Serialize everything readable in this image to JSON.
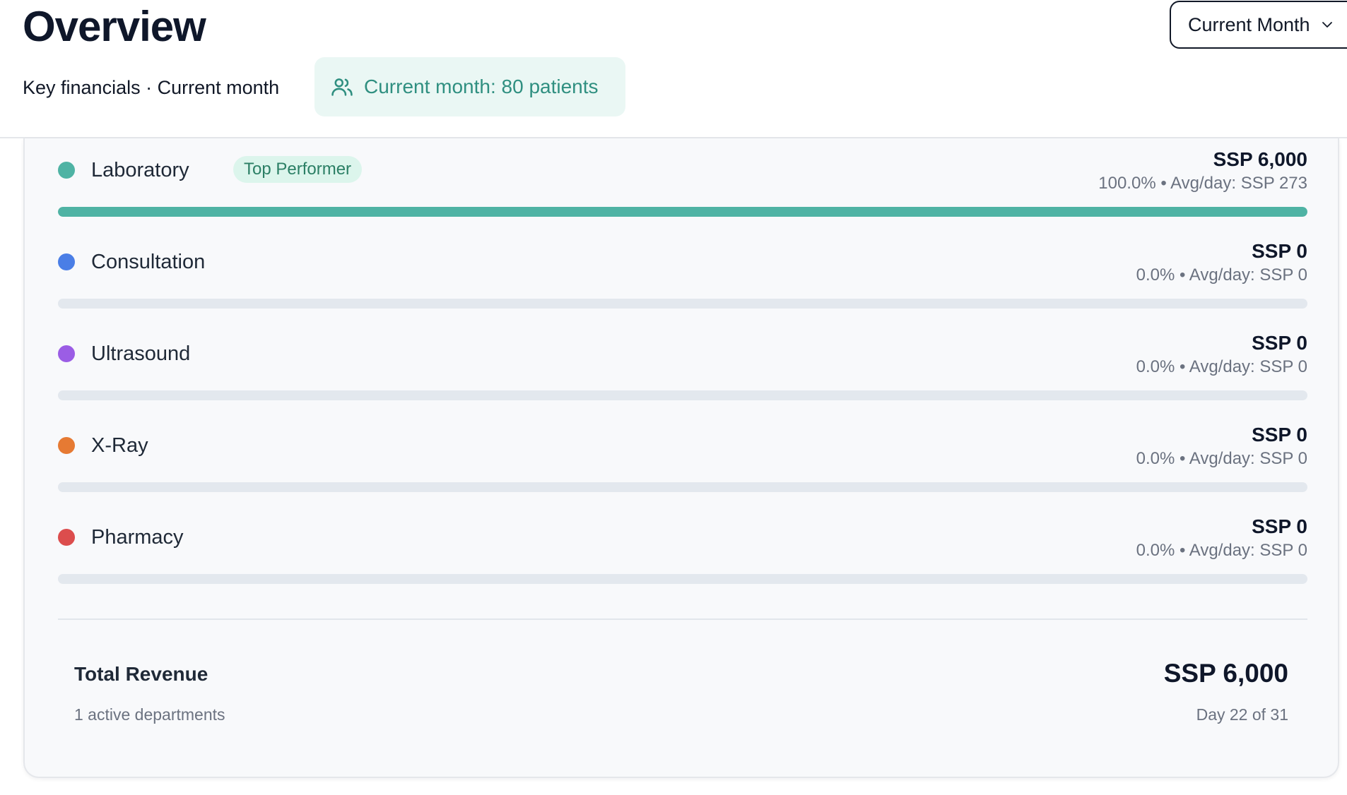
{
  "header": {
    "title": "Overview",
    "subtitle": "Key financials · Current month",
    "patients_pill": {
      "label": "Current month: 80 patients",
      "icon": "users-icon"
    },
    "period_select": {
      "value": "Current Month",
      "icon": "chevron-down-icon"
    }
  },
  "colors": {
    "laboratory": "#4fb3a4",
    "consultation": "#4a7ee6",
    "ultrasound": "#9b5de5",
    "xray": "#e67a33",
    "pharmacy": "#dc4d4d",
    "accent": "#2f8f80"
  },
  "departments": [
    {
      "name": "Laboratory",
      "badge": "Top Performer",
      "amount": "SSP 6,000",
      "meta": "100.0% • Avg/day: SSP 273",
      "share": 1.0,
      "color": "#4fb3a4"
    },
    {
      "name": "Consultation",
      "badge": "",
      "amount": "SSP 0",
      "meta": "0.0% • Avg/day: SSP 0",
      "share": 0.0,
      "color": "#4a7ee6"
    },
    {
      "name": "Ultrasound",
      "badge": "",
      "amount": "SSP 0",
      "meta": "0.0% • Avg/day: SSP 0",
      "share": 0.0,
      "color": "#9b5de5"
    },
    {
      "name": "X-Ray",
      "badge": "",
      "amount": "SSP 0",
      "meta": "0.0% • Avg/day: SSP 0",
      "share": 0.0,
      "color": "#e67a33"
    },
    {
      "name": "Pharmacy",
      "badge": "",
      "amount": "SSP 0",
      "meta": "0.0% • Avg/day: SSP 0",
      "share": 0.0,
      "color": "#dc4d4d"
    }
  ],
  "total": {
    "label": "Total Revenue",
    "amount": "SSP 6,000",
    "active_departments": "1 active departments",
    "day": "Day 22 of 31"
  }
}
